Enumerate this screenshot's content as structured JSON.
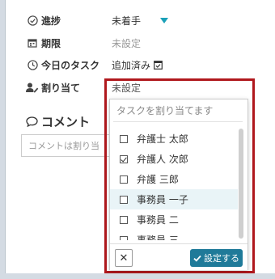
{
  "fields": {
    "progress": {
      "label": "進捗",
      "icon": "check-circle-icon"
    },
    "deadline": {
      "label": "期限",
      "icon": "calendar-icon",
      "value": "未設定"
    },
    "today_task": {
      "label": "今日のタスク",
      "icon": "clock-icon",
      "value": "追加済み",
      "value_icon": "calendar-check-icon"
    },
    "assignee": {
      "label": "割り当て",
      "icon": "user-edit-icon",
      "value": "未設定"
    }
  },
  "status_select": {
    "selected": "未着手"
  },
  "comment": {
    "title": "コメント",
    "icon": "speech-bubble-icon",
    "placeholder": "コメントは割り当"
  },
  "assign_dropdown": {
    "placeholder": "タスクを割り当てます",
    "options": [
      {
        "label": "弁護士 太郎",
        "checked": false
      },
      {
        "label": "弁護人 次郎",
        "checked": true
      },
      {
        "label": "弁護 三郎",
        "checked": false
      },
      {
        "label": "事務員 一子",
        "checked": false
      },
      {
        "label": "事務員 二",
        "checked": false
      },
      {
        "label": "事務員 三",
        "checked": false
      }
    ],
    "close_label": "✕",
    "apply_label": "設定する"
  },
  "colors": {
    "accent": "#1f7a99",
    "highlight": "#b0181d",
    "caret": "#1aa0b8"
  }
}
